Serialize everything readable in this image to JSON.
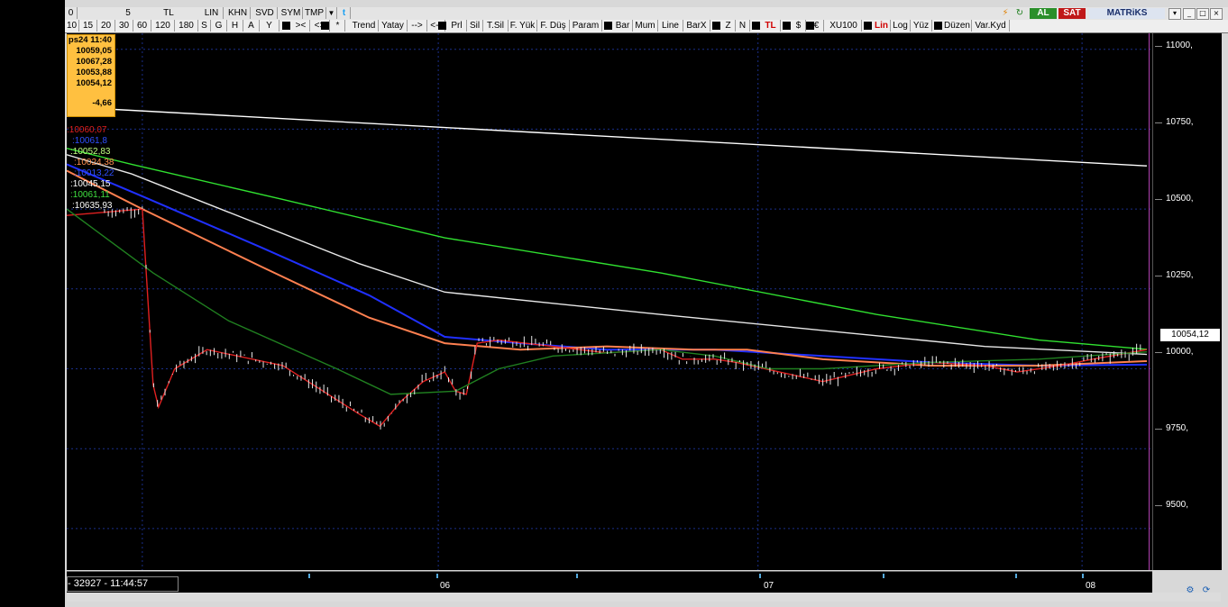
{
  "toolbar_top": {
    "items": [
      "0",
      "5",
      "TL",
      "LIN",
      "KHN",
      "SVD",
      "SYM",
      "TMP"
    ],
    "buy_label": "AL",
    "sell_label": "SAT",
    "brand": "MATRiKS"
  },
  "toolbar_second": {
    "periods": [
      "10",
      "15",
      "20",
      "30",
      "60",
      "120",
      "180",
      "S",
      "G",
      "H",
      "A",
      "Y"
    ],
    "buttons": [
      ">",
      "<>",
      "*",
      "Trend",
      "Yatay",
      "-->",
      "<--",
      "Prl",
      "Sil",
      "T.Sil",
      "F. Yük",
      "F. Düş",
      "Param",
      "Bar",
      "Mum",
      "Line",
      "BarX",
      "Z",
      "N",
      "TL",
      "$",
      "€",
      "XU100",
      "Lin",
      "Log",
      "Yüz",
      "Düzen",
      "Var.Kyd"
    ]
  },
  "info_box": {
    "time": "ps24 11:40",
    "open": "10059,05",
    "high": "10067,28",
    "low": "10053,88",
    "close": "10054,12",
    "change": "-4,66"
  },
  "ma_labels": [
    {
      "text": ":10060,07",
      "color": "#e02020"
    },
    {
      "text": ":10061,8",
      "color": "#3050ff"
    },
    {
      "text": ":10052,83",
      "color": "#c0ff80"
    },
    {
      "text": ":10024,38",
      "color": "#ff9050"
    },
    {
      "text": ":10013,22",
      "color": "#3050ff"
    },
    {
      "text": ":10045,15",
      "color": "#ffffff"
    },
    {
      "text": ":10061,11",
      "color": "#40e040"
    },
    {
      "text": ":10635,93",
      "color": "#ffffff"
    }
  ],
  "y_axis": {
    "labels": [
      "11000,",
      "10750,",
      "10500,",
      "10250,",
      "10000,",
      "9750,",
      "9500,"
    ],
    "current_price": "10054,12"
  },
  "x_axis": {
    "labels": [
      "06",
      "07",
      "08"
    ]
  },
  "status": {
    "text": "- 32927 - 11:44:57"
  },
  "chart_data": {
    "type": "line",
    "y_range": [
      9370,
      11050
    ],
    "series": [
      {
        "id": "sma_long",
        "color": "#ffffff",
        "values": [
          [
            0,
            10820
          ],
          [
            1,
            10635
          ]
        ]
      },
      {
        "id": "sma_green",
        "color": "#30e030",
        "values": [
          [
            0,
            10690
          ],
          [
            0.06,
            10640
          ],
          [
            0.2,
            10530
          ],
          [
            0.35,
            10410
          ],
          [
            0.55,
            10300
          ],
          [
            0.75,
            10170
          ],
          [
            0.9,
            10090
          ],
          [
            1,
            10061
          ]
        ]
      },
      {
        "id": "sma_white",
        "color": "#e8e8e8",
        "values": [
          [
            0,
            10670
          ],
          [
            0.06,
            10610
          ],
          [
            0.15,
            10490
          ],
          [
            0.27,
            10330
          ],
          [
            0.35,
            10240
          ],
          [
            0.55,
            10170
          ],
          [
            0.7,
            10120
          ],
          [
            0.85,
            10070
          ],
          [
            1,
            10045
          ]
        ]
      },
      {
        "id": "sma_blue",
        "color": "#2030ff",
        "values": [
          [
            0,
            10640
          ],
          [
            0.07,
            10540
          ],
          [
            0.18,
            10380
          ],
          [
            0.28,
            10230
          ],
          [
            0.35,
            10100
          ],
          [
            0.42,
            10080
          ],
          [
            0.5,
            10060
          ],
          [
            0.6,
            10060
          ],
          [
            0.7,
            10040
          ],
          [
            0.8,
            10020
          ],
          [
            0.9,
            10010
          ],
          [
            1,
            10013
          ]
        ]
      },
      {
        "id": "sma_orange",
        "color": "#ff8050",
        "values": [
          [
            0,
            10620
          ],
          [
            0.07,
            10500
          ],
          [
            0.18,
            10320
          ],
          [
            0.28,
            10160
          ],
          [
            0.35,
            10080
          ],
          [
            0.42,
            10060
          ],
          [
            0.5,
            10070
          ],
          [
            0.58,
            10060
          ],
          [
            0.63,
            10060
          ],
          [
            0.7,
            10030
          ],
          [
            0.8,
            10010
          ],
          [
            0.9,
            10010
          ],
          [
            1,
            10024
          ]
        ]
      },
      {
        "id": "ema_red",
        "color": "#e02020",
        "values": [
          [
            0,
            10480
          ],
          [
            0.07,
            10500
          ],
          [
            0.08,
            9950
          ],
          [
            0.085,
            9880
          ],
          [
            0.1,
            10000
          ],
          [
            0.13,
            10060
          ],
          [
            0.2,
            10010
          ],
          [
            0.27,
            9860
          ],
          [
            0.29,
            9820
          ],
          [
            0.31,
            9900
          ],
          [
            0.33,
            9960
          ],
          [
            0.35,
            9990
          ],
          [
            0.36,
            9930
          ],
          [
            0.37,
            9920
          ],
          [
            0.38,
            10080
          ],
          [
            0.4,
            10090
          ],
          [
            0.5,
            10050
          ],
          [
            0.55,
            10060
          ],
          [
            0.57,
            10030
          ],
          [
            0.6,
            10030
          ],
          [
            0.62,
            10020
          ],
          [
            0.66,
            9990
          ],
          [
            0.7,
            9960
          ],
          [
            0.75,
            10000
          ],
          [
            0.8,
            10020
          ],
          [
            0.85,
            10010
          ],
          [
            0.88,
            9990
          ],
          [
            0.92,
            10010
          ],
          [
            0.95,
            10030
          ],
          [
            1,
            10060
          ]
        ]
      },
      {
        "id": "sma_darkgreen",
        "color": "#208020",
        "values": [
          [
            0,
            10500
          ],
          [
            0.08,
            10300
          ],
          [
            0.15,
            10150
          ],
          [
            0.25,
            10000
          ],
          [
            0.3,
            9920
          ],
          [
            0.36,
            9930
          ],
          [
            0.4,
            10000
          ],
          [
            0.45,
            10040
          ],
          [
            0.5,
            10050
          ],
          [
            0.55,
            10060
          ],
          [
            0.6,
            10040
          ],
          [
            0.65,
            10000
          ],
          [
            0.7,
            10000
          ],
          [
            0.8,
            10020
          ],
          [
            0.9,
            10030
          ],
          [
            1,
            10053
          ]
        ]
      }
    ]
  }
}
